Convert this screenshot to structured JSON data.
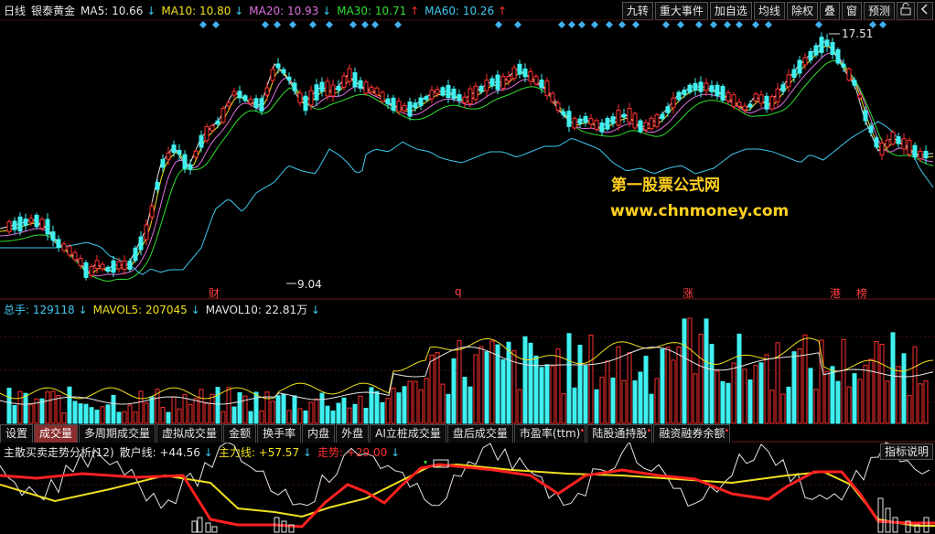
{
  "header": {
    "period": "日线",
    "name": "银泰黄金",
    "ma5": "MA5: 10.66",
    "ma10": "MA10: 10.80",
    "ma20": "MA20: 10.93",
    "ma30": "MA30: 10.71",
    "ma60": "MA60: 10.26",
    "arrow_down": "↓",
    "arrow_up": "↑"
  },
  "toolbar": {
    "jiuzhuan": "九转",
    "events": "重大事件",
    "add_fav": "加自选",
    "ma_line": "均线",
    "rights": "除权",
    "overlay": "叠",
    "window": "窗",
    "predict": "预测"
  },
  "price_labels": {
    "high": "17.51",
    "low": "9.04"
  },
  "event_markers": [
    "财",
    "q",
    "涨",
    "港",
    "榜"
  ],
  "watermark": {
    "line1": "第一股票公式网",
    "line2": "www.chnmoney.com"
  },
  "volume": {
    "total": "总手: 129118",
    "mavol5": "MAVOL5: 207045",
    "mavol10": "MAVOL10: 22.81万"
  },
  "tabs": [
    "设置",
    "成交量",
    "多周期成交量",
    "虚拟成交量",
    "金额",
    "换手率",
    "内盘",
    "外盘",
    "AI立桩成交量",
    "盘后成交量",
    "市盈率(ttm)",
    "陆股通持股",
    "融资融券余额"
  ],
  "indicator": {
    "name": "主散买卖走势分析(12)",
    "retail": "散户线: +44.56",
    "main": "主力线: +57.57",
    "trend": "走势: +29.00",
    "help_button": "指标说明"
  },
  "colors": {
    "up": "#ff3030",
    "down": "#40f0f0",
    "ma5": "#e6e6e6",
    "ma10": "#f0e020",
    "ma20": "#e070e0",
    "ma30": "#30e030",
    "ma60": "#40c8f0"
  }
}
